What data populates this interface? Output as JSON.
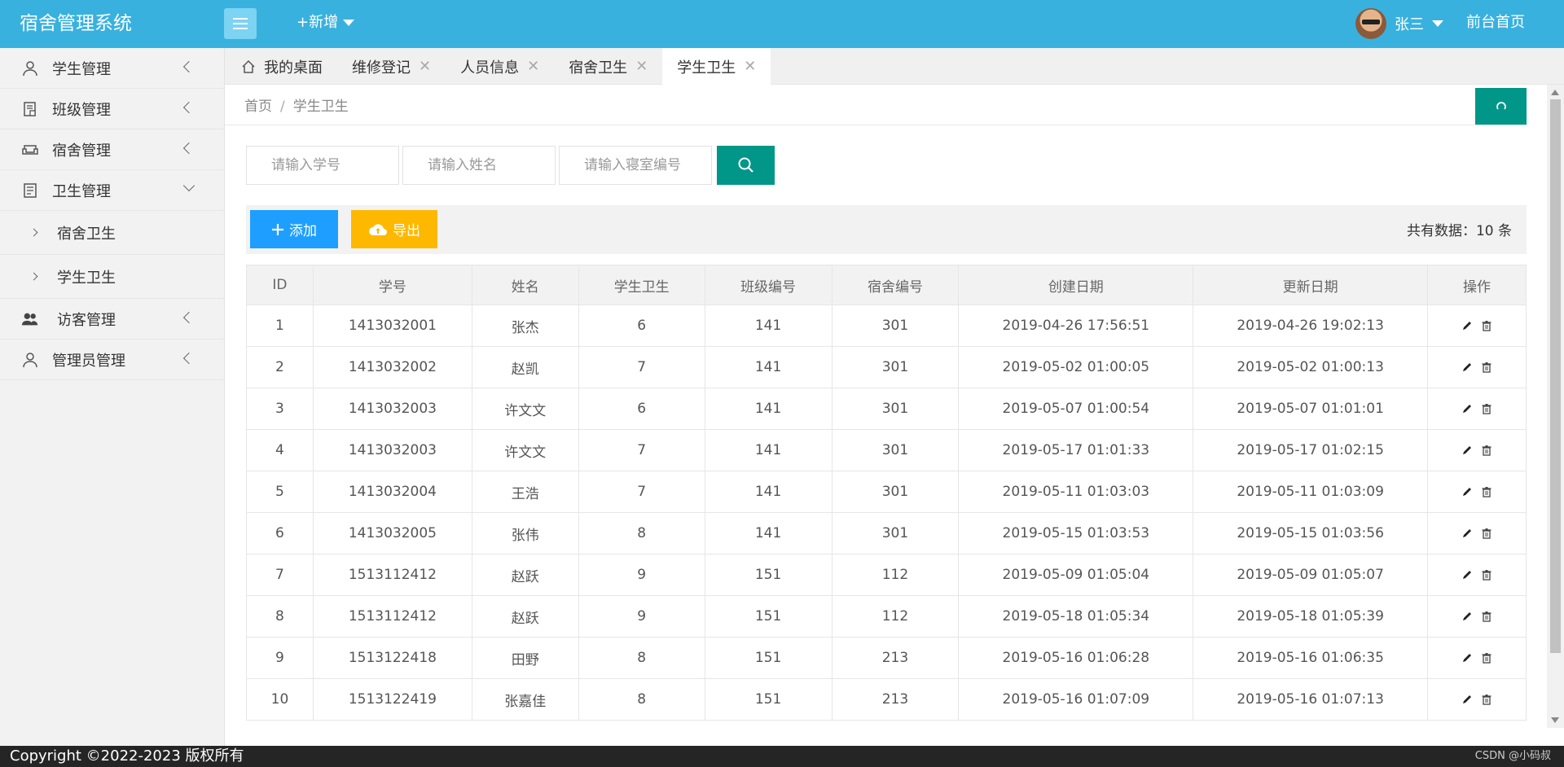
{
  "header": {
    "title": "宿舍管理系统",
    "new_label": "+新增",
    "user_name": "张三",
    "front_link": "前台首页"
  },
  "sidebar": {
    "items": [
      {
        "label": "学生管理",
        "icon": "user-icon"
      },
      {
        "label": "班级管理",
        "icon": "class-icon"
      },
      {
        "label": "宿舍管理",
        "icon": "sofa-icon"
      },
      {
        "label": "卫生管理",
        "icon": "document-icon"
      },
      {
        "label": "访客管理",
        "icon": "users-icon"
      },
      {
        "label": "管理员管理",
        "icon": "user-icon"
      }
    ],
    "sub_items": [
      {
        "label": "宿舍卫生"
      },
      {
        "label": "学生卫生"
      }
    ]
  },
  "tabs": [
    {
      "label": "我的桌面"
    },
    {
      "label": "维修登记"
    },
    {
      "label": "人员信息"
    },
    {
      "label": "宿舍卫生"
    },
    {
      "label": "学生卫生"
    }
  ],
  "breadcrumb": {
    "home": "首页",
    "sep": "/",
    "current": "学生卫生"
  },
  "search": {
    "student_no_placeholder": "请输入学号",
    "name_placeholder": "请输入姓名",
    "dorm_no_placeholder": "请输入寝室编号"
  },
  "toolbar": {
    "add_label": "添加",
    "export_label": "导出",
    "total_text": "共有数据：10 条"
  },
  "table": {
    "headers": [
      "ID",
      "学号",
      "姓名",
      "学生卫生",
      "班级编号",
      "宿舍编号",
      "创建日期",
      "更新日期",
      "操作"
    ],
    "rows": [
      [
        "1",
        "1413032001",
        "张杰",
        "6",
        "141",
        "301",
        "2019-04-26 17:56:51",
        "2019-04-26 19:02:13"
      ],
      [
        "2",
        "1413032002",
        "赵凯",
        "7",
        "141",
        "301",
        "2019-05-02 01:00:05",
        "2019-05-02 01:00:13"
      ],
      [
        "3",
        "1413032003",
        "许文文",
        "6",
        "141",
        "301",
        "2019-05-07 01:00:54",
        "2019-05-07 01:01:01"
      ],
      [
        "4",
        "1413032003",
        "许文文",
        "7",
        "141",
        "301",
        "2019-05-17 01:01:33",
        "2019-05-17 01:02:15"
      ],
      [
        "5",
        "1413032004",
        "王浩",
        "7",
        "141",
        "301",
        "2019-05-11 01:03:03",
        "2019-05-11 01:03:09"
      ],
      [
        "6",
        "1413032005",
        "张伟",
        "8",
        "141",
        "301",
        "2019-05-15 01:03:53",
        "2019-05-15 01:03:56"
      ],
      [
        "7",
        "1513112412",
        "赵跃",
        "9",
        "151",
        "112",
        "2019-05-09 01:05:04",
        "2019-05-09 01:05:07"
      ],
      [
        "8",
        "1513112412",
        "赵跃",
        "9",
        "151",
        "112",
        "2019-05-18 01:05:34",
        "2019-05-18 01:05:39"
      ],
      [
        "9",
        "1513122418",
        "田野",
        "8",
        "151",
        "213",
        "2019-05-16 01:06:28",
        "2019-05-16 01:06:35"
      ],
      [
        "10",
        "1513122419",
        "张嘉佳",
        "8",
        "151",
        "213",
        "2019-05-16 01:07:09",
        "2019-05-16 01:07:13"
      ]
    ]
  },
  "footer": {
    "copyright": "Copyright ©2022-2023 版权所有",
    "watermark": "CSDN @小码叔"
  },
  "colors": {
    "header_bg": "#39b1df",
    "primary": "#009688",
    "add_btn": "#1e9fff",
    "export_btn": "#ffb800"
  }
}
